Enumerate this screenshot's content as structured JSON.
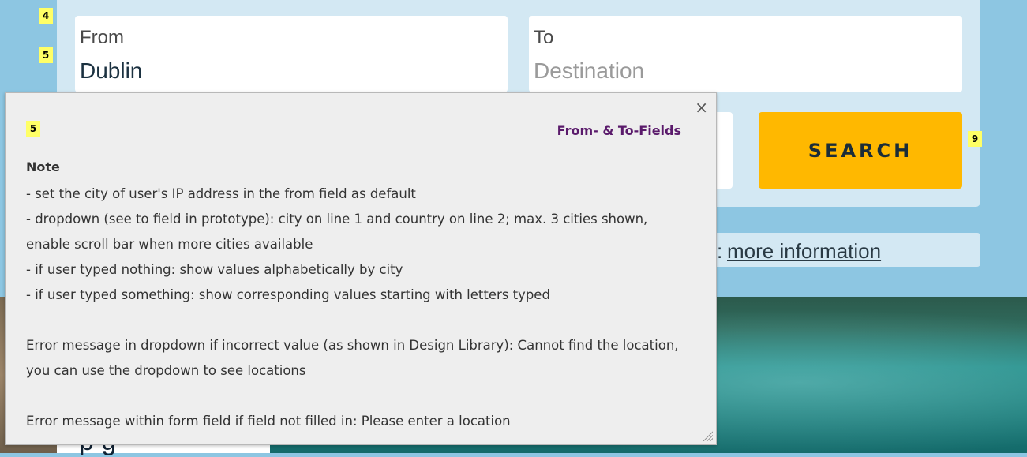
{
  "search_form": {
    "from_label": "From",
    "from_value": "Dublin",
    "to_label": "To",
    "to_placeholder": "Destination",
    "search_button_label": "SEARCH"
  },
  "info_bar": {
    "colon": ":",
    "link_text": "more information"
  },
  "markers": {
    "m4": "4",
    "m5": "5",
    "m5_note": "5",
    "m9": "9"
  },
  "note": {
    "close_icon": "×",
    "title": "From- & To-Fields",
    "heading": "Note",
    "lines": [
      "- set the city of user's IP address in the from field as default",
      "- dropdown (see to field in prototype): city on line 1 and country on line 2; max. 3 cities shown, enable scroll bar when more cities available",
      "- if user typed nothing: show values alphabetically by city",
      "- if user typed something: show corresponding values starting with letters typed",
      "",
      "Error message in dropdown if incorrect value (as shown in Design Library): Cannot find the location, you can use the dropdown to see locations",
      "",
      "Error message within form field if field not filled in: Please enter a location"
    ]
  },
  "strip_text": "p g"
}
